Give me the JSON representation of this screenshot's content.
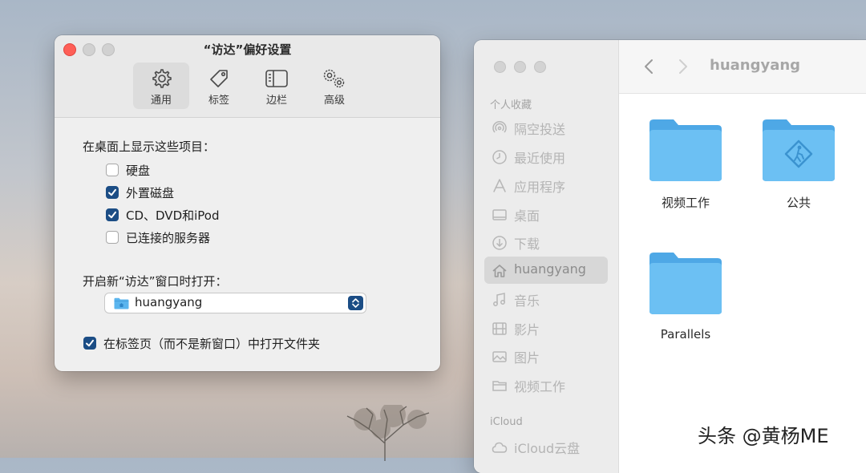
{
  "prefs": {
    "title": "“访达”偏好设置",
    "tabs": [
      {
        "label": "通用",
        "icon": "gear-icon"
      },
      {
        "label": "标签",
        "icon": "tag-icon"
      },
      {
        "label": "边栏",
        "icon": "sidebar-icon"
      },
      {
        "label": "高级",
        "icon": "gears-icon"
      }
    ],
    "desktop_section": "在桌面上显示这些项目：",
    "items": [
      {
        "label": "硬盘",
        "checked": false
      },
      {
        "label": "外置磁盘",
        "checked": true
      },
      {
        "label": "CD、DVD和iPod",
        "checked": true
      },
      {
        "label": "已连接的服务器",
        "checked": false
      }
    ],
    "new_window_label": "开启新“访达”窗口时打开：",
    "new_window_value": "huangyang",
    "open_in_tabs": {
      "label": "在标签页（而不是新窗口）中打开文件夹",
      "checked": true
    }
  },
  "finder": {
    "title": "huangyang",
    "favorites_header": "个人收藏",
    "sidebar": [
      {
        "label": "隔空投送",
        "icon": "airdrop-icon"
      },
      {
        "label": "最近使用",
        "icon": "clock-icon"
      },
      {
        "label": "应用程序",
        "icon": "applications-icon"
      },
      {
        "label": "桌面",
        "icon": "desktop-icon"
      },
      {
        "label": "下载",
        "icon": "download-icon"
      },
      {
        "label": "huangyang",
        "icon": "home-icon",
        "selected": true
      },
      {
        "label": "音乐",
        "icon": "music-icon"
      },
      {
        "label": "影片",
        "icon": "film-icon"
      },
      {
        "label": "图片",
        "icon": "photo-icon"
      },
      {
        "label": "视频工作",
        "icon": "folder-icon"
      }
    ],
    "icloud_header": "iCloud",
    "icloud_items": [
      {
        "label": "iCloud云盘",
        "icon": "cloud-icon"
      }
    ],
    "files": [
      {
        "label": "视频工作",
        "icon": "folder-icon"
      },
      {
        "label": "公共",
        "icon": "public-folder-icon"
      },
      {
        "label": "Parallels",
        "icon": "folder-icon"
      }
    ]
  },
  "watermark": "头条 @黄杨ME",
  "colors": {
    "accent": "#1b4d85",
    "close": "#fe5f57",
    "folder": "#5bb5ee"
  }
}
